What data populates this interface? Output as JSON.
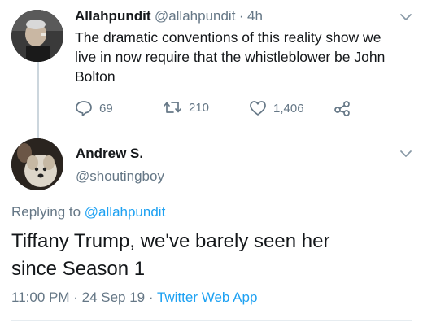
{
  "parent_tweet": {
    "display_name": "Allahpundit",
    "handle": "@allahpundit",
    "separator": "·",
    "time": "4h",
    "text_line1": "The dramatic conventions of this reality show we",
    "text_line2": "live in now require that the whistleblower be John",
    "text_line3": "Bolton",
    "replies_count": "69",
    "retweets_count": "210",
    "likes_count": "1,406"
  },
  "reply_tweet": {
    "display_name": "Andrew S.",
    "handle": "@shoutingboy",
    "replying_to_prefix": "Replying to",
    "replying_to_handle": "@allahpundit",
    "text_line1": "Tiffany Trump, we've barely seen her",
    "text_line2": "since Season 1",
    "timestamp": "11:00 PM · 24 Sep 19",
    "footer_separator": "·",
    "client": "Twitter Web App"
  },
  "icons": {
    "reply": "speech-bubble-icon",
    "retweet": "retweet-icon",
    "like": "heart-icon",
    "share": "share-icon",
    "menu": "chevron-down-icon"
  },
  "colors": {
    "link": "#1da1f2",
    "secondary_text": "#657786",
    "primary_text": "#14171a"
  }
}
